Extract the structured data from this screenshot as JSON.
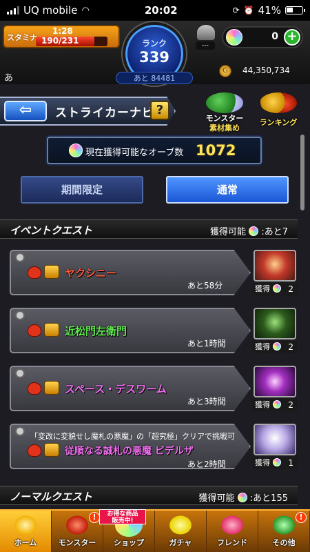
{
  "status_bar": {
    "carrier": "UQ mobile",
    "time": "20:02",
    "battery": "41%"
  },
  "header": {
    "stamina_label": "スタミナ",
    "stamina_timer": "1:28",
    "stamina_value": "190/231",
    "stamina_level": 0.82,
    "rank_label": "ランク",
    "rank_value": "339",
    "rank_next": "あと 84481",
    "gem_slot_value": "---",
    "orb_count": "0",
    "plus_label": "+",
    "user_name": "あ",
    "gold_value": "44,350,734"
  },
  "titlebar": {
    "back_label": "⇦",
    "title": "ストライカーナビ",
    "help_label": "?",
    "material_label_1": "モンスター",
    "material_label_2": "素材集め",
    "ranking_label": "ランキング"
  },
  "orb_banner": {
    "text": "現在獲得可能なオーブ数",
    "count": "1072"
  },
  "tabs": {
    "limited": "期間限定",
    "normal": "通常"
  },
  "event_section": {
    "title": "イベントクエスト",
    "available": "獲得可能",
    "remaining": ":あと7"
  },
  "quests": [
    {
      "name": "ヤクシニー",
      "time": "あと58分",
      "gain_label": "獲得",
      "orbs": "2",
      "color": "#ff5a3a",
      "note": ""
    },
    {
      "name": "近松門左衛門",
      "time": "あと1時間",
      "gain_label": "獲得",
      "orbs": "2",
      "color": "#5ee84d",
      "note": ""
    },
    {
      "name": "スペース・デスワーム",
      "time": "あと3時間",
      "gain_label": "獲得",
      "orbs": "2",
      "color": "#f06ef0",
      "note": ""
    },
    {
      "name": "従順なる誠札の悪魔 ビデルザ",
      "time": "あと2時間",
      "gain_label": "獲得",
      "orbs": "1",
      "color": "#f06ef0",
      "note": "「変改に変貌せし魔札の悪魔」の「超究極」クリアで挑戦可"
    }
  ],
  "normal_section": {
    "title": "ノーマルクエスト",
    "available": "獲得可能",
    "remaining": ":あと155"
  },
  "bottom_nav": {
    "home": "ホーム",
    "monster": "モンスター",
    "shop": "ショップ",
    "gacha": "ガチャ",
    "friend": "フレンド",
    "other": "その他",
    "sale_tag_1": "お得な商品",
    "sale_tag_2": "販売中!",
    "alert": "!"
  }
}
